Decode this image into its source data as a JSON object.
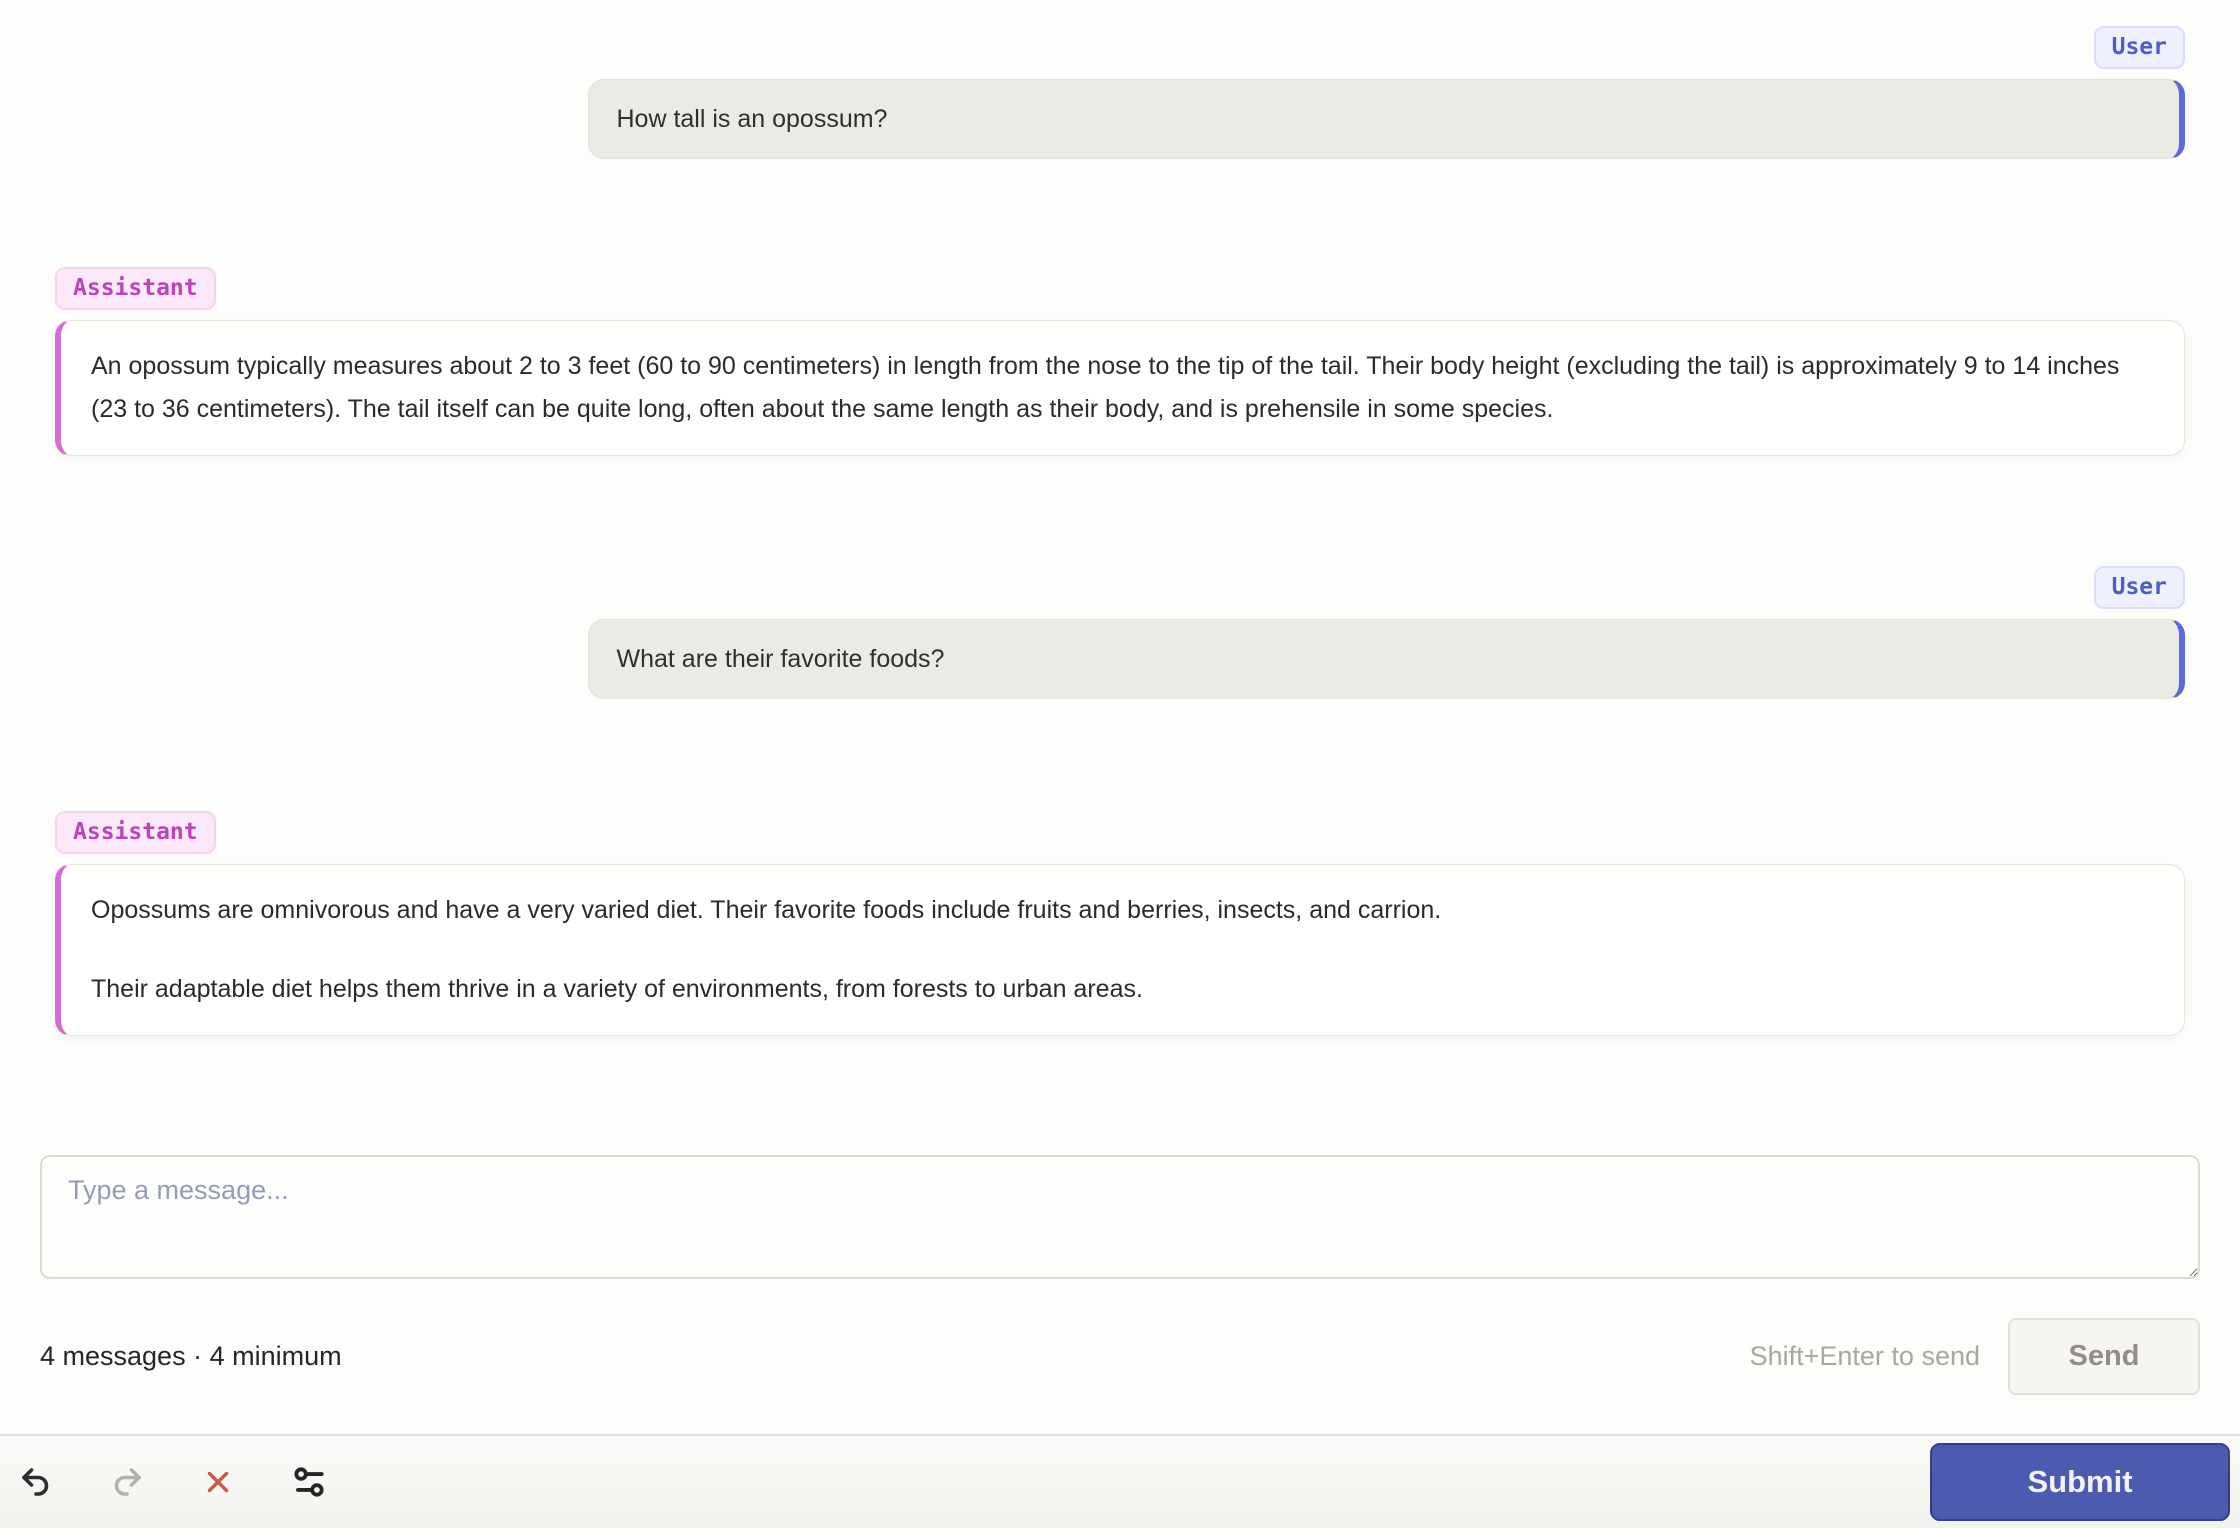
{
  "colors": {
    "user_accent": "#5b69de",
    "user_badge_text": "#4d5dc7",
    "user_bubble_bg": "#ebeae5",
    "assistant_accent": "#d36fd0",
    "assistant_badge_text": "#bb44b9",
    "danger_red": "#c75b48",
    "submit_bg": "#4c5bb0",
    "page_bg": "#fdfdfb"
  },
  "chat": {
    "messages": [
      {
        "role": "User",
        "text": "How tall is an opossum?"
      },
      {
        "role": "Assistant",
        "paragraphs": [
          "An opossum typically measures about 2 to 3 feet (60 to 90 centimeters) in length from the nose to the tip of the tail. Their body height (excluding the tail) is approximately 9 to 14 inches (23 to 36 centimeters). The tail itself can be quite long, often about the same length as their body, and is prehensile in some species."
        ]
      },
      {
        "role": "User",
        "text": "What are their favorite foods?"
      },
      {
        "role": "Assistant",
        "paragraphs": [
          "Opossums are omnivorous and have a very varied diet. Their favorite foods include fruits and berries, insects, and carrion.",
          "Their adaptable diet helps them thrive in a variety of environments, from forests to urban areas."
        ]
      }
    ]
  },
  "composer": {
    "placeholder": "Type a message...",
    "status": "4 messages · 4 minimum",
    "hint": "Shift+Enter to send",
    "send_label": "Send"
  },
  "toolbar": {
    "icons": [
      "undo",
      "redo",
      "clear",
      "settings"
    ],
    "submit_label": "Submit"
  }
}
